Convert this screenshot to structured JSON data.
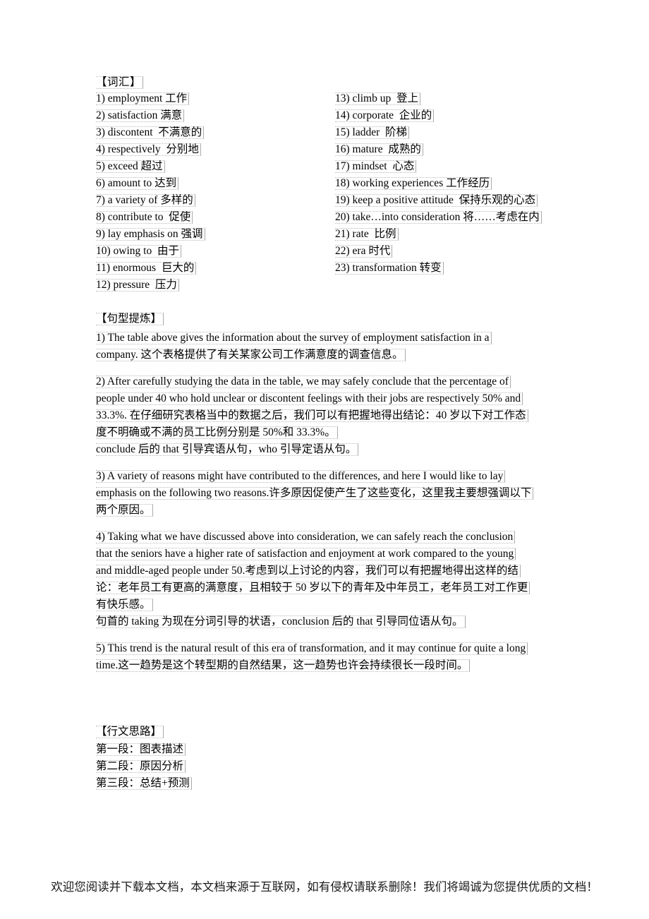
{
  "vocabulary": {
    "heading": "【词汇】",
    "left_items": [
      "1) employment 工作",
      "2) satisfaction 满意",
      "3) discontent  不满意的",
      "4) respectively  分别地",
      "5) exceed 超过",
      "6) amount to 达到",
      "7) a variety of 多样的",
      "8) contribute to  促使",
      "9) lay emphasis on 强调",
      "10) owing to  由于",
      "11) enormous  巨大的",
      "12) pressure  压力"
    ],
    "right_items": [
      "13) climb up  登上",
      "14) corporate  企业的",
      "15) ladder  阶梯",
      "16) mature  成熟的",
      "17) mindset  心态",
      "18) working experiences 工作经历",
      "19) keep a positive attitude  保持乐观的心态",
      "20) take…into consideration 将……考虑在内",
      "21) rate  比例",
      "22) era 时代",
      "23) transformation 转变"
    ]
  },
  "patterns": {
    "heading": "【句型提炼】",
    "blocks": [
      {
        "lines": [
          "1) The table above gives the information about the survey of employment satisfaction in a",
          "company. 这个表格提供了有关某家公司工作满意度的调查信息。"
        ],
        "note": ""
      },
      {
        "lines": [
          "2) After carefully studying the data in the table, we may safely conclude that the percentage of",
          "people under 40 who hold unclear or discontent feelings with their jobs are respectively 50% and",
          "33.3%. 在仔细研究表格当中的数据之后，我们可以有把握地得出结论：40 岁以下对工作态",
          "度不明确或不满的员工比例分别是 50%和 33.3%。"
        ],
        "note": "conclude 后的 that 引导宾语从句，who 引导定语从句。"
      },
      {
        "lines": [
          "3) A variety of reasons might have contributed to the differences, and here I would like to lay",
          "emphasis on the following two reasons.许多原因促使产生了这些变化，这里我主要想强调以下",
          "两个原因。"
        ],
        "note": ""
      },
      {
        "lines": [
          "4) Taking what we have discussed above into consideration, we can safely reach the conclusion",
          "that the seniors have a higher rate of satisfaction and enjoyment at work compared to the young",
          "and middle-aged people under 50.考虑到以上讨论的内容，我们可以有把握地得出这样的结",
          "论：老年员工有更高的满意度，且相较于 50 岁以下的青年及中年员工，老年员工对工作更",
          "有快乐感。"
        ],
        "note": "句首的 taking 为现在分词引导的状语，conclusion 后的 that 引导同位语从句。"
      },
      {
        "lines": [
          "5) This trend is the natural result of this era of transformation, and it may continue for quite a long",
          "time.这一趋势是这个转型期的自然结果，这一趋势也许会持续很长一段时间。"
        ],
        "note": ""
      }
    ]
  },
  "outline": {
    "heading": "【行文思路】",
    "items": [
      "第一段：图表描述",
      "第二段：原因分析",
      "第三段：总结+预测"
    ]
  },
  "footer": {
    "text": "欢迎您阅读并下载本文档，本文档来源于互联网，如有侵权请联系删除！我们将竭诚为您提供优质的文档！"
  }
}
